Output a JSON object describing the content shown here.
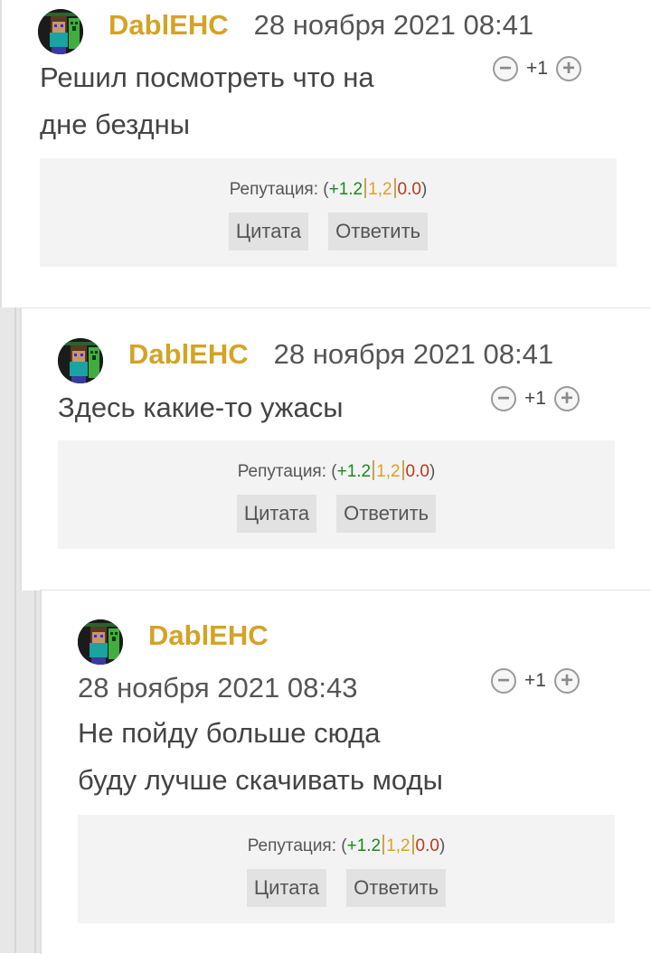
{
  "comments": [
    {
      "username": "DablEHC",
      "date": "28 ноября 2021 08:41",
      "text_lines": [
        "Решил посмотреть что на",
        "дне бездны"
      ],
      "vote_count": "+1",
      "reputation": {
        "label": "Репутация:",
        "open": "(",
        "positive": "+1.2",
        "neutral": "1,2",
        "negative": "0.0",
        "close": ")"
      },
      "quote_label": "Цитата",
      "reply_label": "Ответить"
    },
    {
      "username": "DablEHC",
      "date": "28 ноября 2021 08:41",
      "text_lines": [
        "Здесь какие-то ужасы"
      ],
      "vote_count": "+1",
      "reputation": {
        "label": "Репутация:",
        "open": "(",
        "positive": "+1.2",
        "neutral": "1,2",
        "negative": "0.0",
        "close": ")"
      },
      "quote_label": "Цитата",
      "reply_label": "Ответить"
    },
    {
      "username": "DablEHC",
      "date": "28 ноября 2021 08:43",
      "text_lines": [
        "Не пойду больше сюда",
        "буду лучше скачивать моды"
      ],
      "vote_count": "+1",
      "reputation": {
        "label": "Репутация:",
        "open": "(",
        "positive": "+1.2",
        "neutral": "1,2",
        "negative": "0.0",
        "close": ")"
      },
      "quote_label": "Цитата",
      "reply_label": "Ответить"
    }
  ],
  "icons": {
    "minus": "minus-circle-icon",
    "plus": "plus-circle-icon",
    "avatar": "creeper-avatar"
  },
  "colors": {
    "username": "#d4a326",
    "rep_positive": "#1a8a1a",
    "rep_neutral": "#e0a020",
    "rep_negative": "#b83a1a"
  }
}
